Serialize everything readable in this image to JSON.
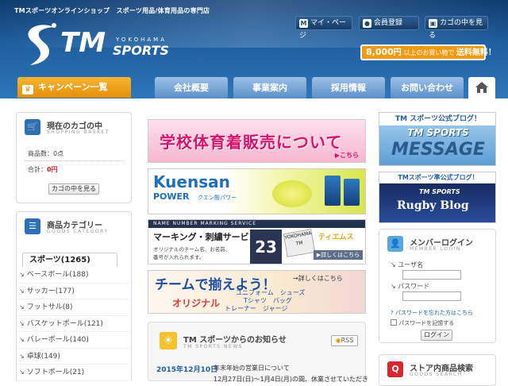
{
  "header": {
    "tagline": "TMスポーツオンラインショップ　スポーツ用品/体育用品の専門店",
    "logo_main": "TM",
    "logo_yokohama": "YOKOHAMA",
    "logo_sports": "SPORTS",
    "top_buttons": [
      {
        "label": "マイ・ページ",
        "icon": "M"
      },
      {
        "label": "会員登録",
        "icon": "person-icon"
      },
      {
        "label": "カゴの中を見る",
        "icon": "cart-icon"
      }
    ],
    "free_shipping": {
      "amount": "8,000",
      "unit": "円",
      "text": "以上のお買い物で",
      "emph": "送料無料！"
    }
  },
  "nav": {
    "campaign": "キャンペーン一覧",
    "items": [
      "会社概要",
      "事業案内",
      "採用情報",
      "お問い合わせ"
    ],
    "home_icon": "home-icon"
  },
  "cart": {
    "title": "現在のカゴの中",
    "subtitle": "SHOPPING BASKET",
    "count_label": "商品数：0点",
    "total_label": "合計：",
    "total_value": "0円",
    "view_button": "カゴの中を見る"
  },
  "category": {
    "title": "商品カテゴリー",
    "subtitle": "GOODS CATEGORY",
    "tab": "スポーツ(1265)",
    "items": [
      "ベースボール(188)",
      "サッカー(177)",
      "フットサル(8)",
      "バスケットボール(121)",
      "バレーボール(140)",
      "卓球(149)",
      "ソフトボール(21)"
    ]
  },
  "banners": {
    "b1": {
      "text": "学校体育着販売について",
      "sub": "こちら"
    },
    "b2": {
      "brand": "Kuensan",
      "power": "POWER",
      "jp": "クエン酸パワー"
    },
    "b3": {
      "small": "NAME NUMBER MARKING SERVICE",
      "title": "マーキング・刺繍サービス",
      "desc1": "オリジナルのチーム名、お名前、",
      "desc2": "番号が入れられます。",
      "link": "詳しくはこちら",
      "number": "23",
      "tm": "YOKOHAMA TM",
      "tiems": "ティエムス"
    },
    "b4": {
      "title": "チームで揃えよう！",
      "link": "詳しくはこちら",
      "orig": "オリジナル",
      "items1": "ユニフォーム　シューズ",
      "items2": "Tシャツ　バッグ",
      "items3": "トレーナー　ジャージ"
    }
  },
  "news": {
    "title": "TM スポーツからのお知らせ",
    "subtitle": "TM SPORTS NEWS",
    "rss": "RSS",
    "date": "2015年12月10日",
    "headline": "年末年始の営業日について",
    "body": "12月27日(日)～1月4日(月)の間、休業させていただき"
  },
  "right": {
    "blog1": {
      "top": "TM スポーツ公式ブログ！",
      "mid": "TM SPORTS",
      "big": "MESSAGE"
    },
    "blog2": {
      "top": "TMスポーツ準公式ブログ！",
      "mid": "TM SPORTS",
      "big": "Rugby Blog"
    },
    "login": {
      "title": "メンバーログイン",
      "subtitle": "MEMBER LOGIN",
      "user_label": "ユーザ名",
      "pass_label": "パスワード",
      "forgot": "パスワードを忘れた方はこちら",
      "remember": "パスワードを記憶する",
      "button": "ログイン"
    },
    "search": {
      "title": "ストア内商品検索",
      "subtitle": "GOODS SEARCH"
    }
  }
}
